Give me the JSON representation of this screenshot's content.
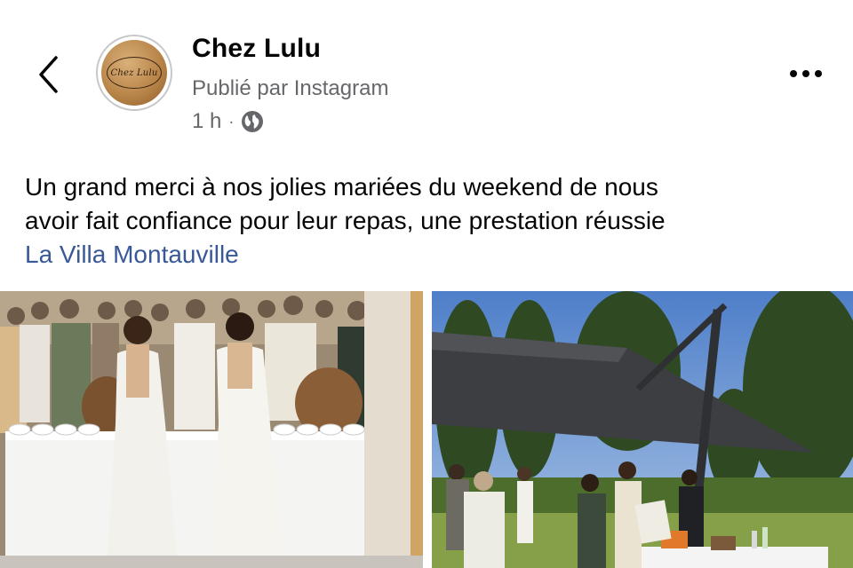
{
  "header": {
    "page_name": "Chez Lulu",
    "published_via": "Publié par Instagram",
    "time_ago": "1 h",
    "separator": "·",
    "back_icon": "chevron-left-icon",
    "visibility_icon": "globe-icon",
    "more_icon": "more-horizontal-icon"
  },
  "avatar": {
    "logo_text": "Chez Lulu"
  },
  "post": {
    "caption_line1": "Un grand merci à nos jolies mariées du weekend de nous",
    "caption_line2": "avoir fait confiance pour leur repas, une prestation réussie",
    "location_tag": "La Villa Montauville"
  },
  "photos": [
    {
      "subject": "wedding-reception-indoor"
    },
    {
      "subject": "garden-party-umbrella"
    }
  ],
  "colors": {
    "link": "#385898",
    "secondary_text": "#65676b",
    "primary_text": "#050505",
    "background": "#ffffff"
  }
}
